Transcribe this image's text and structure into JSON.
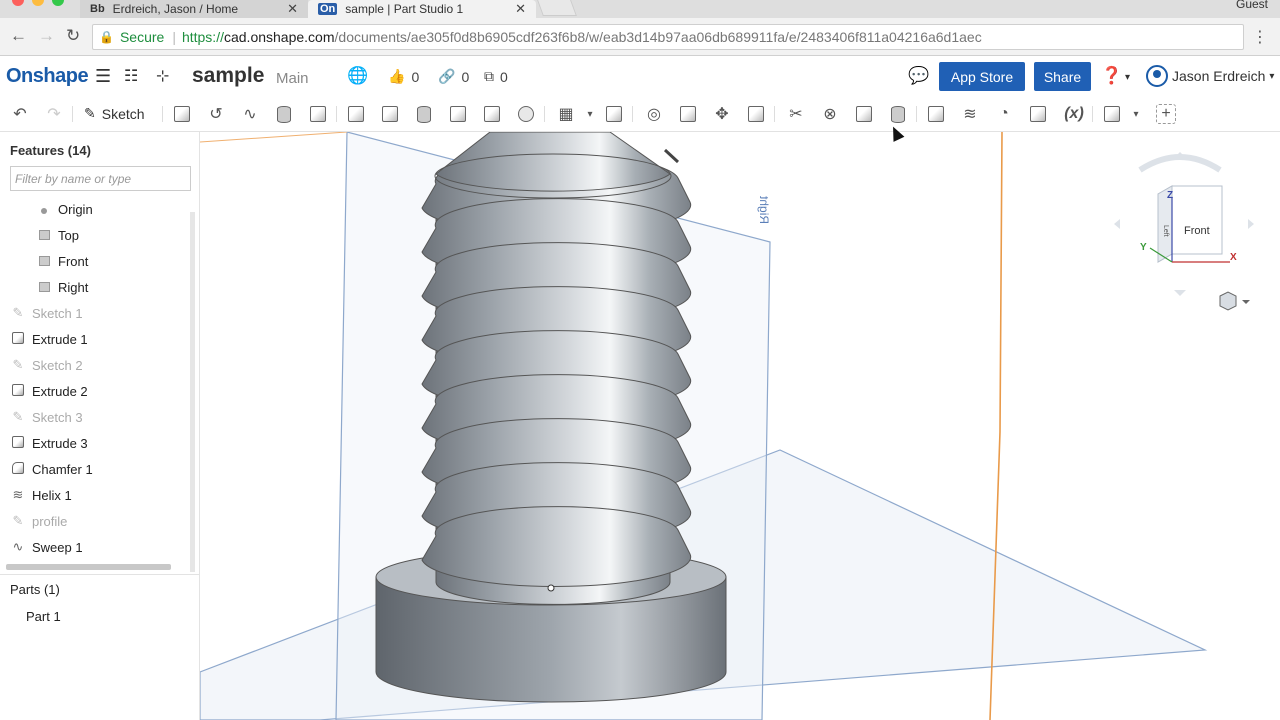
{
  "browser": {
    "tabs": [
      {
        "favicon": "Bb",
        "title": "Erdreich, Jason / Home"
      },
      {
        "favicon": "On",
        "title": "sample | Part Studio 1"
      }
    ],
    "profile": "Guest",
    "secure_label": "Secure",
    "url_scheme": "https://",
    "url_host": "cad.onshape.com",
    "url_path": "/documents/ae305f0d8b6905cdf263f6b8/w/eab3d14b97aa06db689911fa/e/2483406f811a04216a6d1aec"
  },
  "header": {
    "logo": "Onshape",
    "document_name": "sample",
    "branch": "Main",
    "likes": "0",
    "links": "0",
    "copies": "0",
    "app_store": "App Store",
    "share": "Share",
    "user_name": "Jason Erdreich"
  },
  "toolbar": {
    "sketch_label": "Sketch",
    "variable_label": "(x)"
  },
  "features": {
    "title": "Features (14)",
    "filter_placeholder": "Filter by name or type",
    "items": [
      {
        "name": "Origin",
        "icon": "origin-icon",
        "dim": false
      },
      {
        "name": "Top",
        "icon": "plane-icon",
        "dim": false
      },
      {
        "name": "Front",
        "icon": "plane-icon",
        "dim": false
      },
      {
        "name": "Right",
        "icon": "plane-icon",
        "dim": false
      },
      {
        "name": "Sketch 1",
        "icon": "sketch-icon",
        "dim": true
      },
      {
        "name": "Extrude 1",
        "icon": "extrude-icon",
        "dim": false
      },
      {
        "name": "Sketch 2",
        "icon": "sketch-icon",
        "dim": true
      },
      {
        "name": "Extrude 2",
        "icon": "extrude-icon",
        "dim": false
      },
      {
        "name": "Sketch 3",
        "icon": "sketch-icon",
        "dim": true
      },
      {
        "name": "Extrude 3",
        "icon": "extrude-icon",
        "dim": false
      },
      {
        "name": "Chamfer 1",
        "icon": "chamfer-icon",
        "dim": false
      },
      {
        "name": "Helix 1",
        "icon": "helix-icon",
        "dim": false
      },
      {
        "name": "profile",
        "icon": "sketch-icon",
        "dim": true
      },
      {
        "name": "Sweep 1",
        "icon": "sweep-icon",
        "dim": false
      }
    ]
  },
  "parts": {
    "title": "Parts (1)",
    "items": [
      "Part 1"
    ]
  },
  "viewport": {
    "plane_label": "Right",
    "cube_face": "Front",
    "cube_side": "Left",
    "axis_x": "X",
    "axis_y": "Y",
    "axis_z": "Z"
  }
}
